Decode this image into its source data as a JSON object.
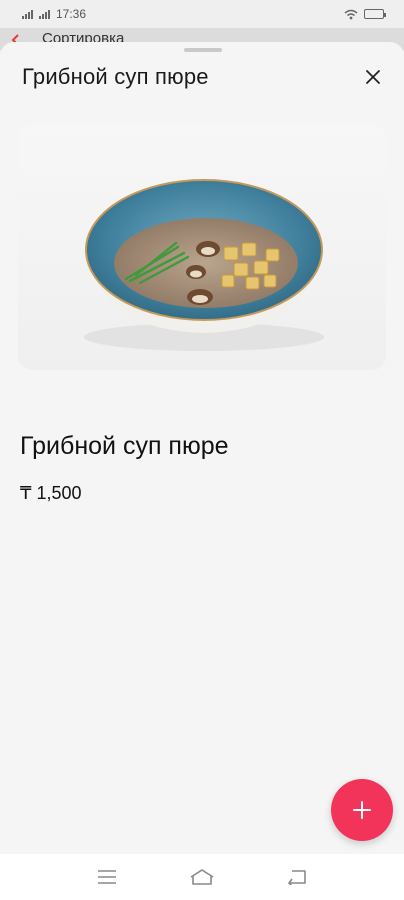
{
  "status_bar": {
    "time": "17:36"
  },
  "background_page": {
    "sort_label": "Сортировка"
  },
  "sheet": {
    "title": "Грибной суп пюре"
  },
  "product": {
    "name": "Грибной суп пюре",
    "price": "₸ 1,500"
  },
  "colors": {
    "accent": "#f2345a",
    "sheet_bg": "#f5f5f5",
    "text": "#111111"
  },
  "icons": {
    "close": "close-icon",
    "add": "plus-icon",
    "nav_menu": "menu-icon",
    "nav_home": "home-icon",
    "nav_back": "back-icon"
  }
}
